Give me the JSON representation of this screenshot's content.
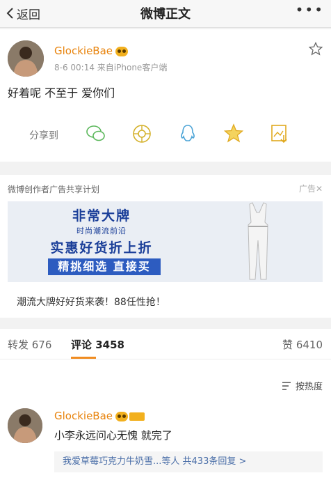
{
  "nav": {
    "back_label": "返回",
    "title": "微博正文",
    "more": "•••"
  },
  "post": {
    "username": "GlockieBae",
    "meta": "8-6 00:14  来自iPhone客户端",
    "text": "好着呢 不至于 爱你们",
    "share_label": "分享到",
    "share_icons": [
      "wechat-icon",
      "moments-icon",
      "qq-icon",
      "qzone-icon",
      "save-image-icon"
    ]
  },
  "ad": {
    "header": "微博创作者广告共享计划",
    "tag": "广告✕",
    "banner": {
      "line1": "非常大牌",
      "line2": "时尚潮流前沿",
      "line3": "实惠好货折上折",
      "line4": "精挑细选  直接买"
    },
    "caption": "潮流大牌好好货来袭！88任性抢！"
  },
  "tabs": {
    "repost": "转发 676",
    "comment": "评论 3458",
    "like": "赞 6410"
  },
  "sort_label": "按热度",
  "comment": {
    "username": "GlockieBae",
    "text": "小李永远问心无愧 就完了",
    "reply_summary": "我爱草莓巧克力牛奶雪...等人  共433条回复 >"
  },
  "colors": {
    "accent": "#f08c20",
    "username": "#e8830c",
    "link": "#4a6ea8",
    "banner_blue": "#2d5cc0"
  }
}
